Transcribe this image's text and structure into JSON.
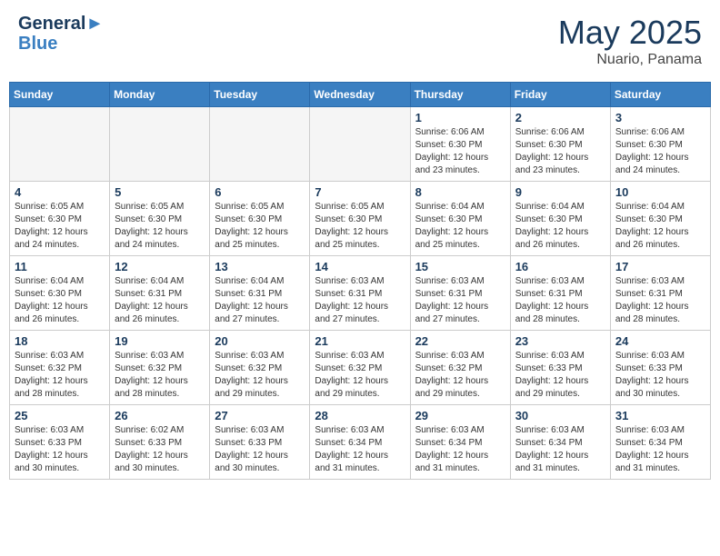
{
  "header": {
    "logo_line1": "General",
    "logo_line2": "Blue",
    "month_year": "May 2025",
    "location": "Nuario, Panama"
  },
  "days_of_week": [
    "Sunday",
    "Monday",
    "Tuesday",
    "Wednesday",
    "Thursday",
    "Friday",
    "Saturday"
  ],
  "weeks": [
    [
      {
        "day": "",
        "empty": true
      },
      {
        "day": "",
        "empty": true
      },
      {
        "day": "",
        "empty": true
      },
      {
        "day": "",
        "empty": true
      },
      {
        "day": "1",
        "sunrise": "6:06 AM",
        "sunset": "6:30 PM",
        "daylight": "12 hours and 23 minutes."
      },
      {
        "day": "2",
        "sunrise": "6:06 AM",
        "sunset": "6:30 PM",
        "daylight": "12 hours and 23 minutes."
      },
      {
        "day": "3",
        "sunrise": "6:06 AM",
        "sunset": "6:30 PM",
        "daylight": "12 hours and 24 minutes."
      }
    ],
    [
      {
        "day": "4",
        "sunrise": "6:05 AM",
        "sunset": "6:30 PM",
        "daylight": "12 hours and 24 minutes."
      },
      {
        "day": "5",
        "sunrise": "6:05 AM",
        "sunset": "6:30 PM",
        "daylight": "12 hours and 24 minutes."
      },
      {
        "day": "6",
        "sunrise": "6:05 AM",
        "sunset": "6:30 PM",
        "daylight": "12 hours and 25 minutes."
      },
      {
        "day": "7",
        "sunrise": "6:05 AM",
        "sunset": "6:30 PM",
        "daylight": "12 hours and 25 minutes."
      },
      {
        "day": "8",
        "sunrise": "6:04 AM",
        "sunset": "6:30 PM",
        "daylight": "12 hours and 25 minutes."
      },
      {
        "day": "9",
        "sunrise": "6:04 AM",
        "sunset": "6:30 PM",
        "daylight": "12 hours and 26 minutes."
      },
      {
        "day": "10",
        "sunrise": "6:04 AM",
        "sunset": "6:30 PM",
        "daylight": "12 hours and 26 minutes."
      }
    ],
    [
      {
        "day": "11",
        "sunrise": "6:04 AM",
        "sunset": "6:30 PM",
        "daylight": "12 hours and 26 minutes."
      },
      {
        "day": "12",
        "sunrise": "6:04 AM",
        "sunset": "6:31 PM",
        "daylight": "12 hours and 26 minutes."
      },
      {
        "day": "13",
        "sunrise": "6:04 AM",
        "sunset": "6:31 PM",
        "daylight": "12 hours and 27 minutes."
      },
      {
        "day": "14",
        "sunrise": "6:03 AM",
        "sunset": "6:31 PM",
        "daylight": "12 hours and 27 minutes."
      },
      {
        "day": "15",
        "sunrise": "6:03 AM",
        "sunset": "6:31 PM",
        "daylight": "12 hours and 27 minutes."
      },
      {
        "day": "16",
        "sunrise": "6:03 AM",
        "sunset": "6:31 PM",
        "daylight": "12 hours and 28 minutes."
      },
      {
        "day": "17",
        "sunrise": "6:03 AM",
        "sunset": "6:31 PM",
        "daylight": "12 hours and 28 minutes."
      }
    ],
    [
      {
        "day": "18",
        "sunrise": "6:03 AM",
        "sunset": "6:32 PM",
        "daylight": "12 hours and 28 minutes."
      },
      {
        "day": "19",
        "sunrise": "6:03 AM",
        "sunset": "6:32 PM",
        "daylight": "12 hours and 28 minutes."
      },
      {
        "day": "20",
        "sunrise": "6:03 AM",
        "sunset": "6:32 PM",
        "daylight": "12 hours and 29 minutes."
      },
      {
        "day": "21",
        "sunrise": "6:03 AM",
        "sunset": "6:32 PM",
        "daylight": "12 hours and 29 minutes."
      },
      {
        "day": "22",
        "sunrise": "6:03 AM",
        "sunset": "6:32 PM",
        "daylight": "12 hours and 29 minutes."
      },
      {
        "day": "23",
        "sunrise": "6:03 AM",
        "sunset": "6:33 PM",
        "daylight": "12 hours and 29 minutes."
      },
      {
        "day": "24",
        "sunrise": "6:03 AM",
        "sunset": "6:33 PM",
        "daylight": "12 hours and 30 minutes."
      }
    ],
    [
      {
        "day": "25",
        "sunrise": "6:03 AM",
        "sunset": "6:33 PM",
        "daylight": "12 hours and 30 minutes."
      },
      {
        "day": "26",
        "sunrise": "6:02 AM",
        "sunset": "6:33 PM",
        "daylight": "12 hours and 30 minutes."
      },
      {
        "day": "27",
        "sunrise": "6:03 AM",
        "sunset": "6:33 PM",
        "daylight": "12 hours and 30 minutes."
      },
      {
        "day": "28",
        "sunrise": "6:03 AM",
        "sunset": "6:34 PM",
        "daylight": "12 hours and 31 minutes."
      },
      {
        "day": "29",
        "sunrise": "6:03 AM",
        "sunset": "6:34 PM",
        "daylight": "12 hours and 31 minutes."
      },
      {
        "day": "30",
        "sunrise": "6:03 AM",
        "sunset": "6:34 PM",
        "daylight": "12 hours and 31 minutes."
      },
      {
        "day": "31",
        "sunrise": "6:03 AM",
        "sunset": "6:34 PM",
        "daylight": "12 hours and 31 minutes."
      }
    ]
  ],
  "labels": {
    "sunrise": "Sunrise:",
    "sunset": "Sunset:",
    "daylight": "Daylight:"
  }
}
